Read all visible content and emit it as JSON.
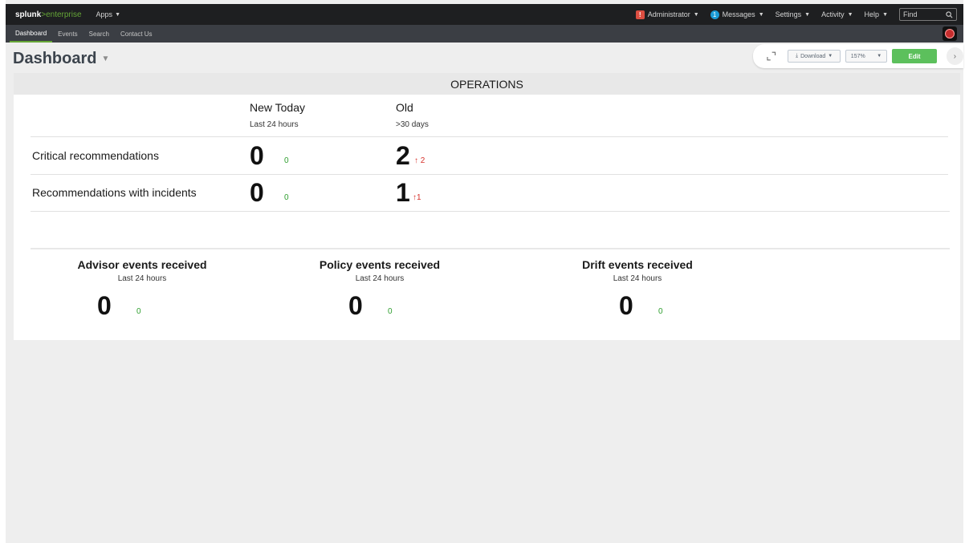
{
  "topbar": {
    "logo_brand": "splunk",
    "logo_sep": ">",
    "logo_product": "enterprise",
    "apps_label": "Apps",
    "admin_badge": "!",
    "admin_label": "Administrator",
    "messages_count": "1",
    "messages_label": "Messages",
    "settings_label": "Settings",
    "activity_label": "Activity",
    "help_label": "Help",
    "find_placeholder": "Find"
  },
  "appbar": {
    "items": [
      {
        "label": "Dashboard",
        "active": true
      },
      {
        "label": "Events",
        "active": false
      },
      {
        "label": "Search",
        "active": false
      },
      {
        "label": "Contact Us",
        "active": false
      }
    ]
  },
  "dashboard": {
    "title": "Dashboard",
    "download_label": "Download",
    "zoom_label": "157%",
    "edit_label": "Edit"
  },
  "operations": {
    "header": "OPERATIONS",
    "columns": [
      {
        "title": "New Today",
        "subtitle": "Last 24 hours"
      },
      {
        "title": "Old",
        "subtitle": ">30 days"
      }
    ],
    "rows": [
      {
        "label": "Critical recommendations",
        "new_value": "0",
        "new_delta": "0",
        "old_value": "2",
        "old_delta": "↑ 2"
      },
      {
        "label": "Recommendations with incidents",
        "new_value": "0",
        "new_delta": "0",
        "old_value": "1",
        "old_delta": "↑1"
      }
    ]
  },
  "events": [
    {
      "title": "Advisor events received",
      "subtitle": "Last 24 hours",
      "value": "0",
      "delta": "0"
    },
    {
      "title": "Policy events received",
      "subtitle": "Last 24 hours",
      "value": "0",
      "delta": "0"
    },
    {
      "title": "Drift events received",
      "subtitle": "Last 24 hours",
      "value": "0",
      "delta": "0"
    }
  ],
  "colors": {
    "accent_green": "#65a637",
    "edit_green": "#5cc05c",
    "delta_green": "#2e9e2e",
    "delta_red": "#d6312b",
    "topbar_bg": "#1e1f21",
    "appbar_bg": "#3b3e44"
  }
}
